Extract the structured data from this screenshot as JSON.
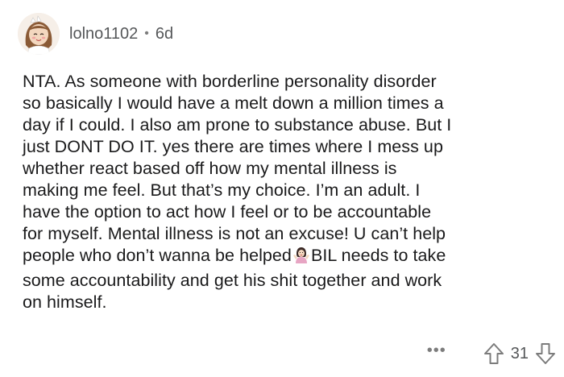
{
  "comment": {
    "author": "lolno1102",
    "age": "6d",
    "separator": "•",
    "lines": [
      "NTA. As someone with borderline personality disorder",
      "so basically I would have a melt down a million times a",
      "day if I could. I also am prone to substance abuse. But I",
      "just DONT DO IT. yes there are times where I mess up",
      "whether react based off how my mental illness is",
      "making me feel. But that’s my choice. I’m an adult. I",
      "have the option to act how I feel or to be accountable",
      "for myself. Mental illness is not an excuse! U can’t help"
    ],
    "line9_before_emoji": "people who don’t wanna be helped",
    "line9_after_emoji": "BIL needs to take",
    "line10": "some accountability and get his shit together and work",
    "line11": "on himself.",
    "emoji_icon": "person-shrugging-icon",
    "more_label": "•••",
    "score": "31",
    "colors": {
      "text": "#1a1a1b",
      "meta": "#555759",
      "icon": "#7c7c7c"
    }
  }
}
